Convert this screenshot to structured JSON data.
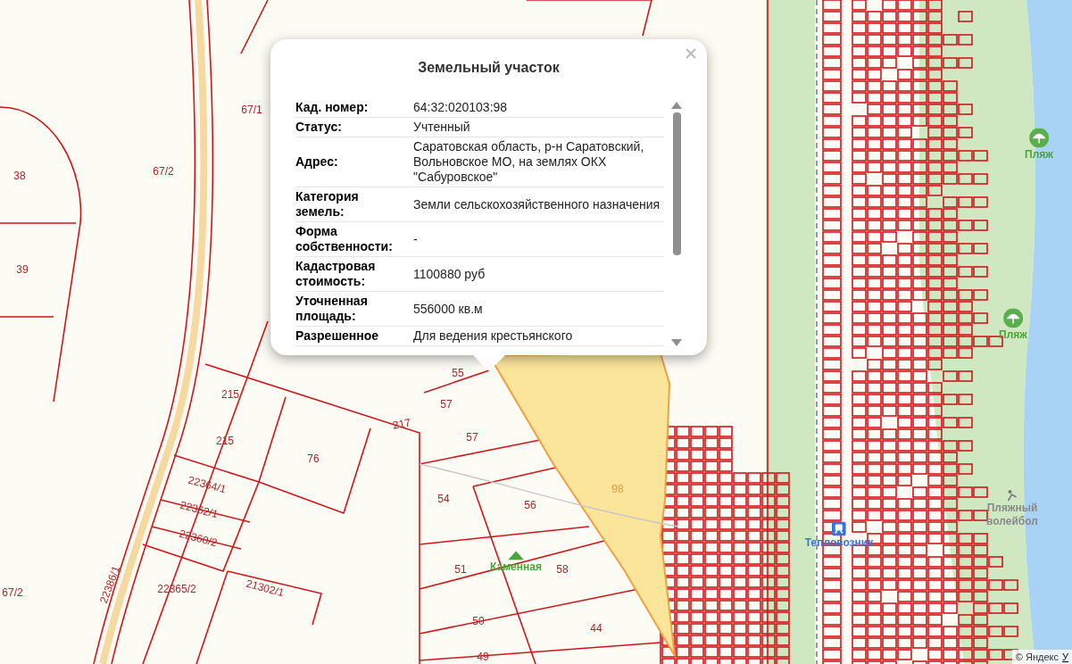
{
  "map": {
    "parcel_labels": [
      {
        "text": "38",
        "kind": "parcel"
      },
      {
        "text": "39",
        "kind": "parcel"
      },
      {
        "text": "67/2",
        "kind": "parcel"
      },
      {
        "text": "67/1",
        "kind": "parcel"
      },
      {
        "text": "67/2",
        "kind": "parcel"
      },
      {
        "text": "215",
        "kind": "parcel"
      },
      {
        "text": "215",
        "kind": "parcel"
      },
      {
        "text": "76",
        "kind": "parcel"
      },
      {
        "text": "217",
        "kind": "parcel"
      },
      {
        "text": "22364/1",
        "kind": "parcel"
      },
      {
        "text": "22362/1",
        "kind": "parcel"
      },
      {
        "text": "22360/2",
        "kind": "parcel"
      },
      {
        "text": "22365/2",
        "kind": "parcel"
      },
      {
        "text": "21302/1",
        "kind": "parcel"
      },
      {
        "text": "22386/1",
        "kind": "parcel"
      },
      {
        "text": "55",
        "kind": "parcel"
      },
      {
        "text": "57",
        "kind": "parcel"
      },
      {
        "text": "57",
        "kind": "parcel"
      },
      {
        "text": "54",
        "kind": "parcel"
      },
      {
        "text": "56",
        "kind": "parcel"
      },
      {
        "text": "51",
        "kind": "parcel"
      },
      {
        "text": "58",
        "kind": "parcel"
      },
      {
        "text": "50",
        "kind": "parcel"
      },
      {
        "text": "44",
        "kind": "parcel"
      },
      {
        "text": "49",
        "kind": "parcel"
      },
      {
        "text": "98",
        "kind": "selected"
      }
    ],
    "pois": [
      {
        "name": "Каменная",
        "kind": "hill"
      },
      {
        "name": "Пляж",
        "kind": "beach"
      },
      {
        "name": "Пляж",
        "kind": "beach"
      },
      {
        "name": "Тепловозник",
        "kind": "station"
      },
      {
        "name": "Пляжный волейбол",
        "kind": "sport"
      }
    ],
    "copyright": "© Яндекс",
    "terms_link": "У"
  },
  "popup": {
    "title": "Земельный участок",
    "rows": [
      {
        "label": "Кад. номер:",
        "value": "64:32:020103:98"
      },
      {
        "label": "Статус:",
        "value": "Учтенный"
      },
      {
        "label": "Адрес:",
        "value": "Саратовская область, р-н Саратовский, Вольновское МО, на землях ОКХ \"Сабуровское\""
      },
      {
        "label": "Категория земель:",
        "value": "Земли сельскохозяйственного назначения"
      },
      {
        "label": "Форма собственности:",
        "value": "-"
      },
      {
        "label": "Кадастровая стоимость:",
        "value": "1100880 руб"
      },
      {
        "label": "Уточненная площадь:",
        "value": "556000 кв.м"
      },
      {
        "label": "Разрешенное",
        "value": "Для ведения крестьянского"
      }
    ]
  }
}
